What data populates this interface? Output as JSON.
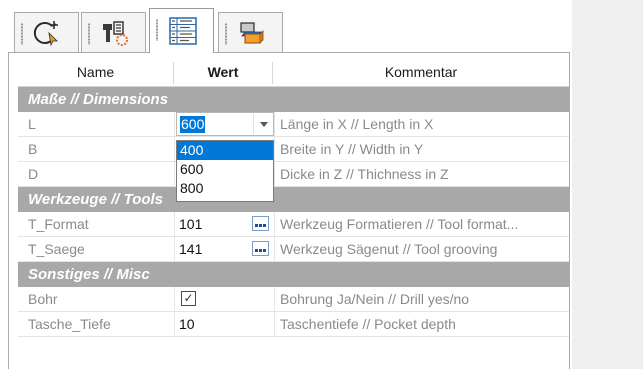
{
  "tabs": [
    {
      "icon": "geometry-cursor-icon",
      "active": false
    },
    {
      "icon": "tool-saw-icon",
      "active": false
    },
    {
      "icon": "property-table-icon",
      "active": true
    },
    {
      "icon": "stacked-boxes-icon",
      "active": false
    }
  ],
  "columns": {
    "name": "Name",
    "value": "Wert",
    "comment": "Kommentar"
  },
  "categories": {
    "dimensions": "Maße // Dimensions",
    "tools": "Werkzeuge // Tools",
    "misc": "Sonstiges // Misc"
  },
  "rows": {
    "L": {
      "name": "L",
      "value": "600",
      "comment": "Länge in X // Length in X"
    },
    "B": {
      "name": "B",
      "value": "",
      "comment": "Breite in Y // Width in Y"
    },
    "D": {
      "name": "D",
      "value": "",
      "comment": "Dicke in Z // Thichness in Z"
    },
    "T_Format": {
      "name": "T_Format",
      "value": "101",
      "comment": "Werkzeug Formatieren // Tool format..."
    },
    "T_Saege": {
      "name": "T_Saege",
      "value": "141",
      "comment": "Werkzeug Sägenut // Tool grooving"
    },
    "Bohr": {
      "name": "Bohr",
      "checked": true,
      "comment": "Bohrung Ja/Nein // Drill yes/no"
    },
    "Tasche_Tiefe": {
      "name": "Tasche_Tiefe",
      "value": "10",
      "comment": "Taschentiefe // Pocket depth"
    }
  },
  "dropdown": {
    "options": [
      "400",
      "600",
      "800"
    ],
    "highlighted_index": 0
  },
  "colors": {
    "category_bg": "#a8a8a8",
    "selection": "#0078d7",
    "ellipsis_border": "#7a9cc8"
  }
}
